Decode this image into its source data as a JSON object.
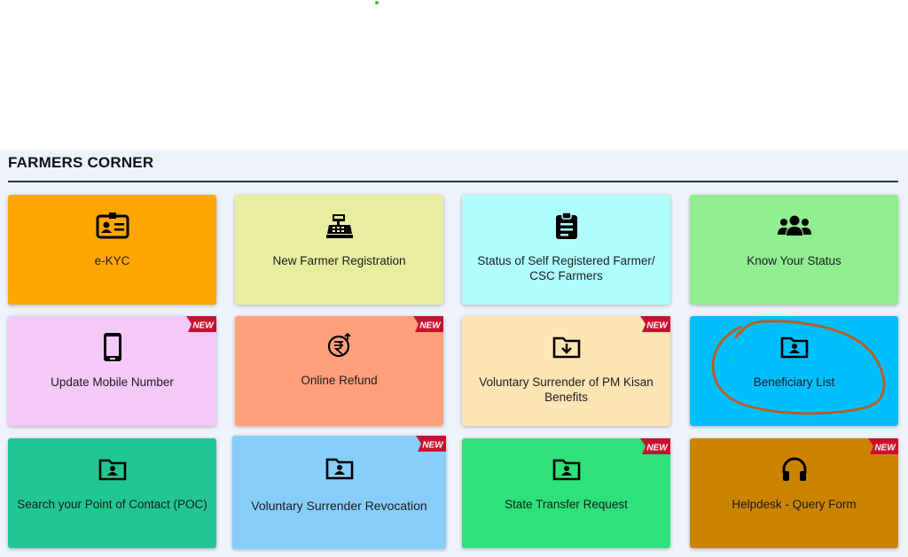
{
  "section": {
    "title": "FARMERS CORNER"
  },
  "badge_text": "NEW",
  "colors": {
    "ekyc": "#ffa600",
    "new_farmer": "#e9eda0",
    "status_self": "#afffff",
    "know_status": "#90ee90",
    "update_mobile": "#f5c9fa",
    "online_refund": "#ffa07a",
    "voluntary_surrender": "#ffe4b5",
    "beneficiary": "#00bfff",
    "poc": "#21c792",
    "revocation": "#87cefa",
    "state_transfer": "#2ee27b",
    "helpdesk": "#cc8400",
    "badge": "#c8102e",
    "rule": "#1f3a4d"
  },
  "cards": [
    {
      "label": "e-KYC",
      "icon": "id-card-icon",
      "new": false
    },
    {
      "label": "New Farmer Registration",
      "icon": "cash-register-icon",
      "new": false
    },
    {
      "label": "Status of Self Registered Farmer/ CSC Farmers",
      "icon": "clipboard-list-icon",
      "new": false
    },
    {
      "label": "Know Your Status",
      "icon": "users-icon",
      "new": false
    },
    {
      "label": "Update Mobile Number",
      "icon": "mobile-phone-icon",
      "new": true
    },
    {
      "label": "Online Refund",
      "icon": "rupee-refund-icon",
      "new": true
    },
    {
      "label": "Voluntary Surrender of PM Kisan Benefits",
      "icon": "folder-download-icon",
      "new": true
    },
    {
      "label": "Beneficiary List",
      "icon": "folder-user-icon",
      "new": false
    },
    {
      "label": "Search your Point of Contact (POC)",
      "icon": "folder-user-icon",
      "new": false
    },
    {
      "label": "Voluntary Surrender Revocation",
      "icon": "folder-user-icon",
      "new": true
    },
    {
      "label": "State Transfer Request",
      "icon": "folder-user-icon",
      "new": true
    },
    {
      "label": "Helpdesk - Query Form",
      "icon": "headphones-icon",
      "new": true
    }
  ]
}
